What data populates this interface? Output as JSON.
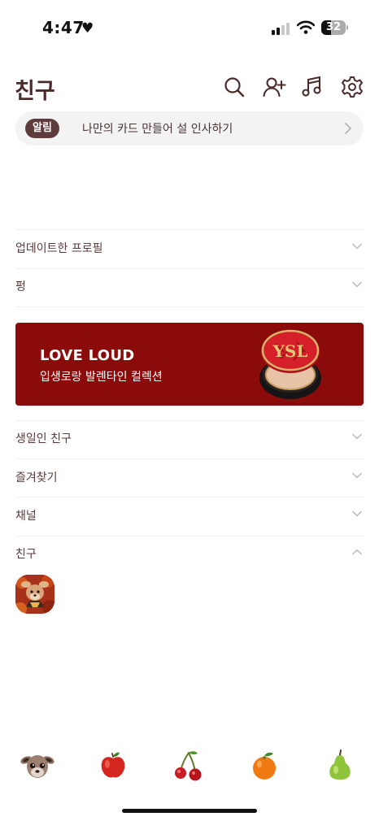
{
  "status_bar": {
    "time": "4:47",
    "battery": "32"
  },
  "header": {
    "title": "친구",
    "icons": [
      "search-icon",
      "add-friend-icon",
      "music-icon",
      "settings-icon"
    ]
  },
  "notice": {
    "badge": "알림",
    "text": "나만의 카드 만들어 설 인사하기"
  },
  "sections": [
    {
      "label": "업데이트한 프로필",
      "expanded": false
    },
    {
      "label": "펑",
      "expanded": false
    },
    {
      "label": "생일인 친구",
      "expanded": false
    },
    {
      "label": "즐겨찾기",
      "expanded": false
    },
    {
      "label": "채널",
      "expanded": false
    },
    {
      "label": "친구",
      "expanded": true
    }
  ],
  "banner": {
    "title": "LOVE LOUD",
    "subtitle": "입생로랑 발렌타인 컬렉션",
    "background": "#8b0b0b"
  },
  "tab_bar": {
    "tabs": [
      "deer-icon",
      "apple-icon",
      "cherry-icon",
      "orange-icon",
      "pear-icon"
    ]
  },
  "colors": {
    "text_primary": "#4a2a2a",
    "badge_bg": "#5e3c3c",
    "notice_bg": "#f3f3f3"
  }
}
